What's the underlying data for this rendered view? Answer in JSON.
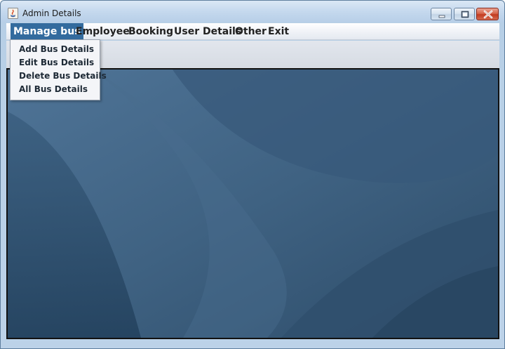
{
  "window": {
    "title": "Admin Details",
    "controls": [
      "minimize-icon",
      "maximize-icon",
      "close-icon"
    ]
  },
  "menubar": {
    "items": [
      {
        "label": "Manage bus",
        "active": true
      },
      {
        "label": "Employee",
        "active": false
      },
      {
        "label": "Booking",
        "active": false
      },
      {
        "label": "User Details",
        "active": false
      },
      {
        "label": "Other",
        "active": false
      },
      {
        "label": "Exit",
        "active": false
      }
    ]
  },
  "manage_bus_menu": {
    "items": [
      {
        "label": "Add Bus Details"
      },
      {
        "label": "Edit Bus Details"
      },
      {
        "label": "Delete Bus Details"
      },
      {
        "label": "All Bus Details"
      }
    ]
  },
  "colors": {
    "menu_active": "#336b9e",
    "desktop_background": "#3d5e7c"
  }
}
